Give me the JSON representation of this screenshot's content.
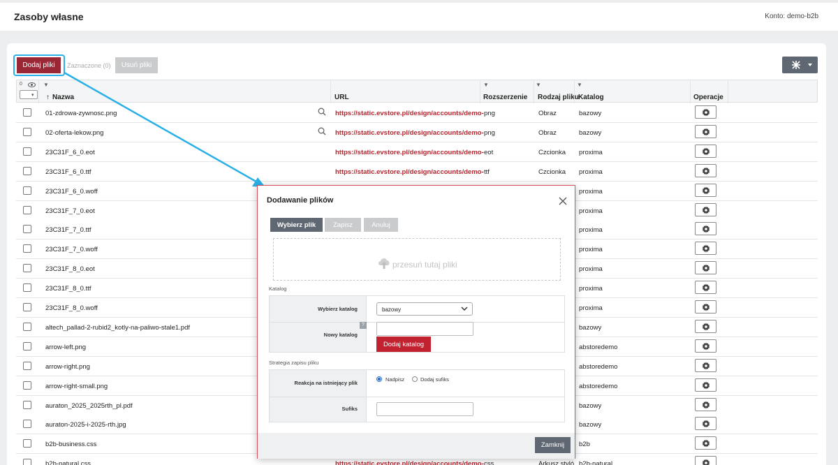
{
  "header": {
    "title": "Zasoby własne",
    "account": "Konto: demo-b2b"
  },
  "toolbar": {
    "add_label": "Dodaj pliki",
    "selected_label": "Zaznaczone (0)",
    "delete_label": "Usuń pliki"
  },
  "table": {
    "counter": "0",
    "headers": {
      "name": "Nazwa",
      "url": "URL",
      "ext": "Rozszerzenie",
      "kind": "Rodzaj pliku",
      "catalog": "Katalog",
      "ops": "Operacje"
    },
    "rows": [
      {
        "name": "01-zdrowa-zywnosc.png",
        "url": "https://static.evstore.pl/design/accounts/demo-",
        "ext": "png",
        "kind": "Obraz",
        "catalog": "bazowy",
        "preview": true
      },
      {
        "name": "02-oferta-lekow.png",
        "url": "https://static.evstore.pl/design/accounts/demo-",
        "ext": "png",
        "kind": "Obraz",
        "catalog": "bazowy",
        "preview": true
      },
      {
        "name": "23C31F_6_0.eot",
        "url": "https://static.evstore.pl/design/accounts/demo-",
        "ext": "eot",
        "kind": "Czcionka",
        "catalog": "proxima"
      },
      {
        "name": "23C31F_6_0.ttf",
        "url": "https://static.evstore.pl/design/accounts/demo-",
        "ext": "ttf",
        "kind": "Czcionka",
        "catalog": "proxima"
      },
      {
        "name": "23C31F_6_0.woff",
        "url": "",
        "ext": "",
        "kind": "",
        "catalog": "proxima"
      },
      {
        "name": "23C31F_7_0.eot",
        "url": "",
        "ext": "",
        "kind": "",
        "catalog": "proxima"
      },
      {
        "name": "23C31F_7_0.ttf",
        "url": "",
        "ext": "",
        "kind": "",
        "catalog": "proxima"
      },
      {
        "name": "23C31F_7_0.woff",
        "url": "",
        "ext": "",
        "kind": "",
        "catalog": "proxima"
      },
      {
        "name": "23C31F_8_0.eot",
        "url": "",
        "ext": "",
        "kind": "",
        "catalog": "proxima"
      },
      {
        "name": "23C31F_8_0.ttf",
        "url": "",
        "ext": "",
        "kind": "",
        "catalog": "proxima"
      },
      {
        "name": "23C31F_8_0.woff",
        "url": "",
        "ext": "",
        "kind": "",
        "catalog": "proxima"
      },
      {
        "name": "altech_pallad-2-rubid2_kotly-na-paliwo-stale1.pdf",
        "url": "",
        "ext": "",
        "kind": "",
        "catalog": "bazowy"
      },
      {
        "name": "arrow-left.png",
        "url": "",
        "ext": "",
        "kind": "",
        "catalog": "abstoredemo"
      },
      {
        "name": "arrow-right.png",
        "url": "",
        "ext": "",
        "kind": "",
        "catalog": "abstoredemo"
      },
      {
        "name": "arrow-right-small.png",
        "url": "",
        "ext": "",
        "kind": "",
        "catalog": "abstoredemo"
      },
      {
        "name": "auraton_2025_2025rth_pl.pdf",
        "url": "",
        "ext": "",
        "kind": "",
        "catalog": "bazowy"
      },
      {
        "name": "auraton-2025-i-2025-rth.jpg",
        "url": "",
        "ext": "",
        "kind": "",
        "catalog": "bazowy"
      },
      {
        "name": "b2b-business.css",
        "url": "",
        "ext": "",
        "kind": "",
        "catalog": "b2b"
      },
      {
        "name": "b2b-natural.css",
        "url": "https://static.evstore.pl/design/accounts/demo-",
        "ext": "css",
        "kind": "Arkusz styló",
        "catalog": "b2b-natural"
      }
    ]
  },
  "modal": {
    "title": "Dodawanie plików",
    "choose_label": "Wybierz plik",
    "save_label": "Zapisz",
    "cancel_label": "Anuluj",
    "dropzone_text": "przesuń tutaj pliki",
    "catalog_section": "Katalog",
    "choose_catalog_label": "Wybierz katalog",
    "catalog_value": "bazowy",
    "new_catalog_label": "Nowy katalog",
    "help_label": "?",
    "add_catalog_label": "Dodaj katalog",
    "strategy_section": "Strategia zapisu pliku",
    "reaction_label": "Reakcja na istniejący plik",
    "option_overwrite": "Nadpisz",
    "option_suffix": "Dodaj sufiks",
    "suffix_label": "Sufiks",
    "close_label": "Zamknij"
  },
  "colors": {
    "brand_red": "#9a2834",
    "url_red": "#b3262f",
    "highlight": "#2ab0e6",
    "dark_button": "#5f6872"
  }
}
